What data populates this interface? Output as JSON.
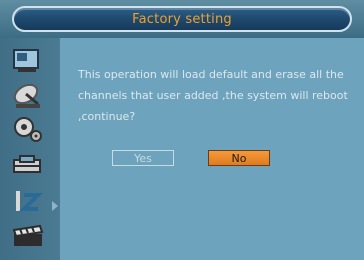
{
  "dialog": {
    "title": "Factory setting",
    "message": "This operation will load default and erase all the channels that user added ,the system will reboot ,continue?",
    "buttons": {
      "yes_label": "Yes",
      "no_label": "No"
    },
    "selected_button": "No"
  },
  "sidebar": {
    "icons": [
      "monitor-icon",
      "satellite-dish-icon",
      "gears-icon",
      "toolbox-icon",
      "alphabet-sort-icon",
      "clapperboard-icon"
    ],
    "active_index": 3
  },
  "colors": {
    "title_text": "#f0a030",
    "selected_button": "#e8892a",
    "content_bg": "#6ea3bd"
  }
}
